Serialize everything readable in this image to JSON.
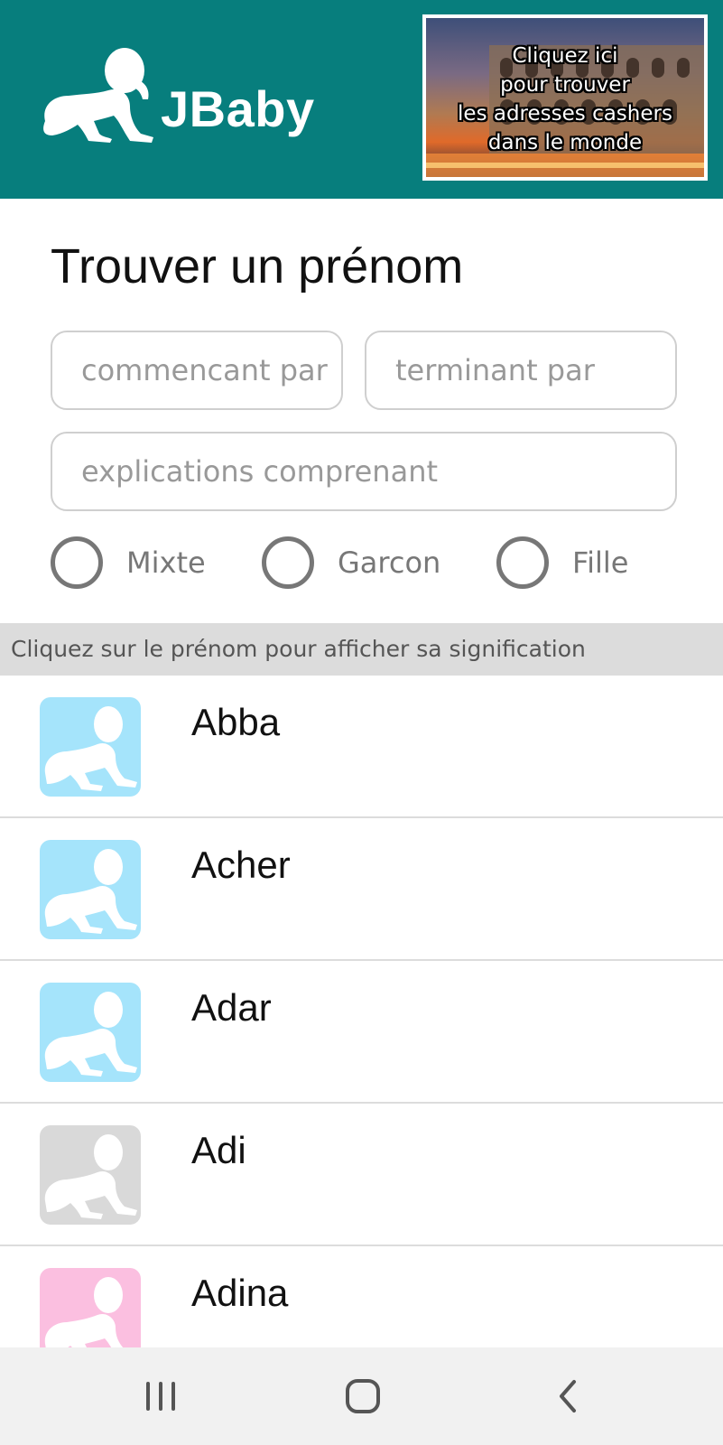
{
  "app": {
    "brand": "JBaby",
    "brand_color": "#077e7d"
  },
  "ad": {
    "lines": [
      "Cliquez ici",
      "pour trouver",
      "les adresses cashers",
      "dans  le monde"
    ]
  },
  "search": {
    "title": "Trouver un prénom",
    "starts_with_placeholder": "commencant par",
    "ends_with_placeholder": "terminant par",
    "explanation_placeholder": "explications comprenant",
    "gender_options": [
      {
        "label": "Mixte",
        "selected": false
      },
      {
        "label": "Garcon",
        "selected": false
      },
      {
        "label": "Fille",
        "selected": false
      }
    ]
  },
  "hint": "Cliquez sur le prénom pour afficher sa signification",
  "names": [
    {
      "name": "Abba",
      "avatar_color": "#a5e4fb"
    },
    {
      "name": "Acher",
      "avatar_color": "#a5e4fb"
    },
    {
      "name": "Adar",
      "avatar_color": "#a5e4fb"
    },
    {
      "name": "Adi",
      "avatar_color": "#d9d9d9"
    },
    {
      "name": "Adina",
      "avatar_color": "#fbbfe0"
    }
  ],
  "navbar": {
    "buttons": [
      "recent-apps-icon",
      "home-icon",
      "back-icon"
    ]
  }
}
